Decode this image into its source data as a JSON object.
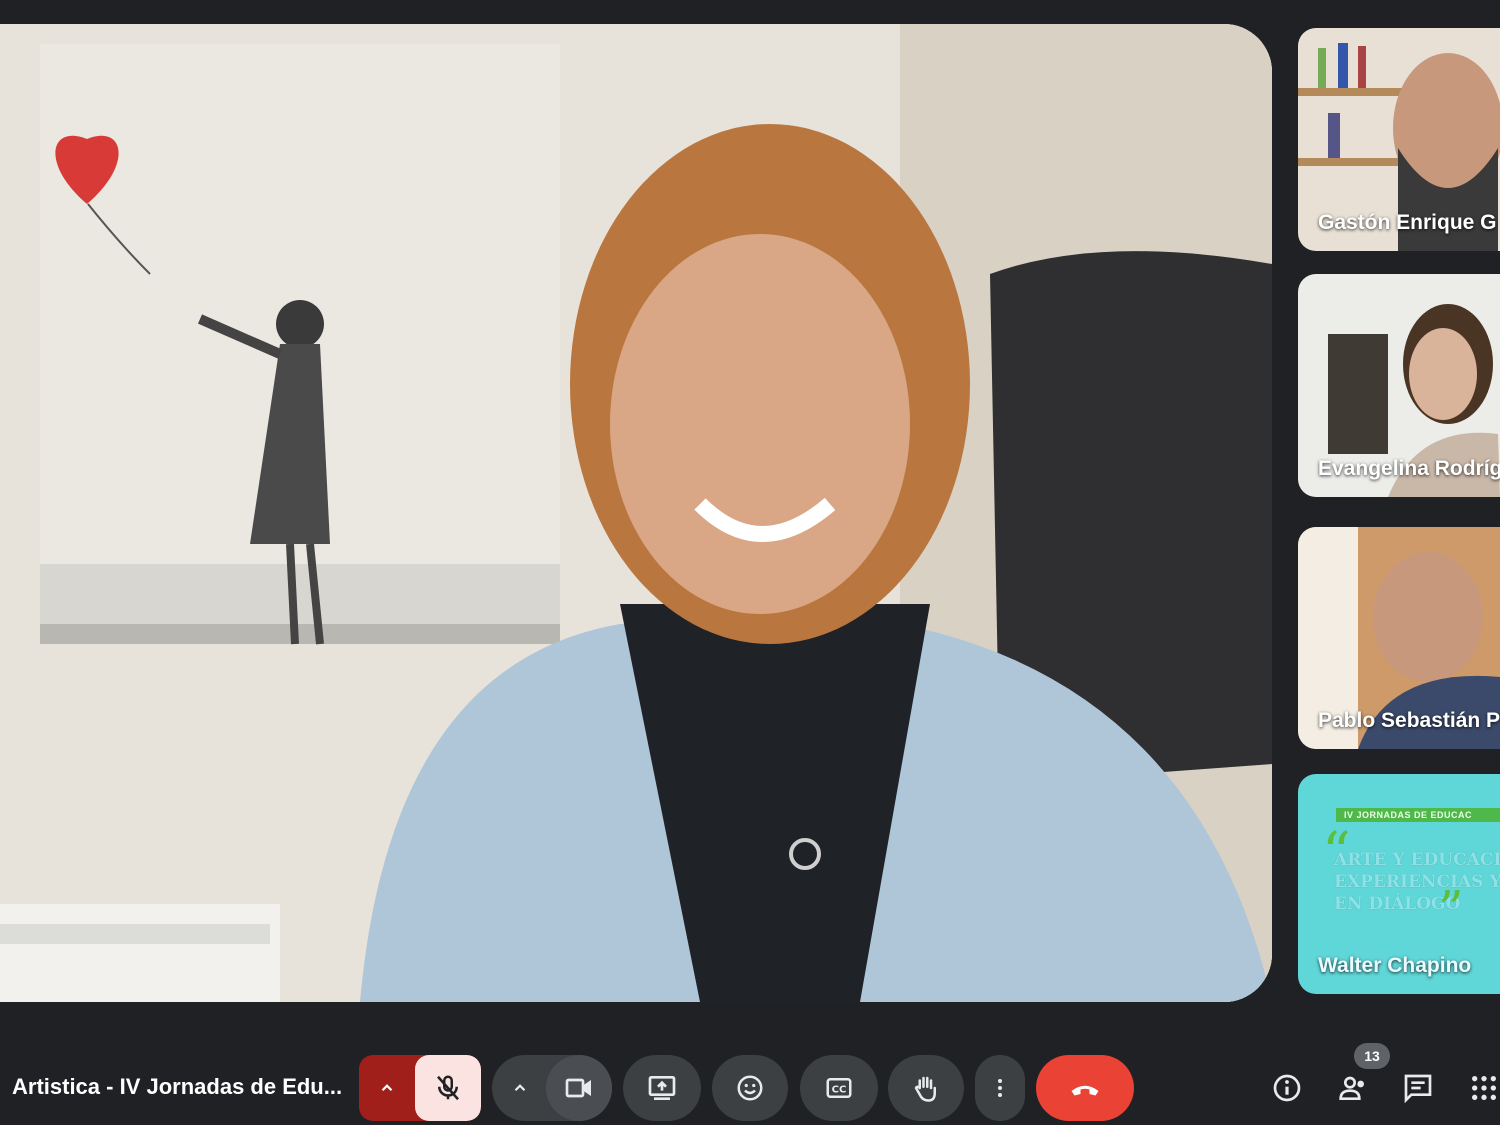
{
  "meeting": {
    "title": "Artistica - IV Jornadas de Edu...",
    "participant_count": "13"
  },
  "participants": [
    {
      "name": "Gastón Enrique G"
    },
    {
      "name": "Evangelina Rodríg"
    },
    {
      "name": "Pablo Sebastián P"
    },
    {
      "name": "Walter Chapino"
    }
  ],
  "presentation": {
    "header": "IV JORNADAS DE EDUCAC",
    "lines": [
      "ARTE Y EDUCACIÓ",
      "EXPERIENCIAS Y P",
      "EN DIÁLOGO"
    ]
  },
  "controls": {
    "mic": "mic-off-icon",
    "camera": "videocam-icon",
    "present": "present-screen-icon",
    "reactions": "emoji-icon",
    "captions": "closed-captions-icon",
    "raise_hand": "raise-hand-icon",
    "more": "more-vert-icon",
    "leave": "call-end-icon"
  },
  "colors": {
    "background": "#202124",
    "end_call": "#ea4335",
    "mic_muted": "#a11f1b"
  }
}
